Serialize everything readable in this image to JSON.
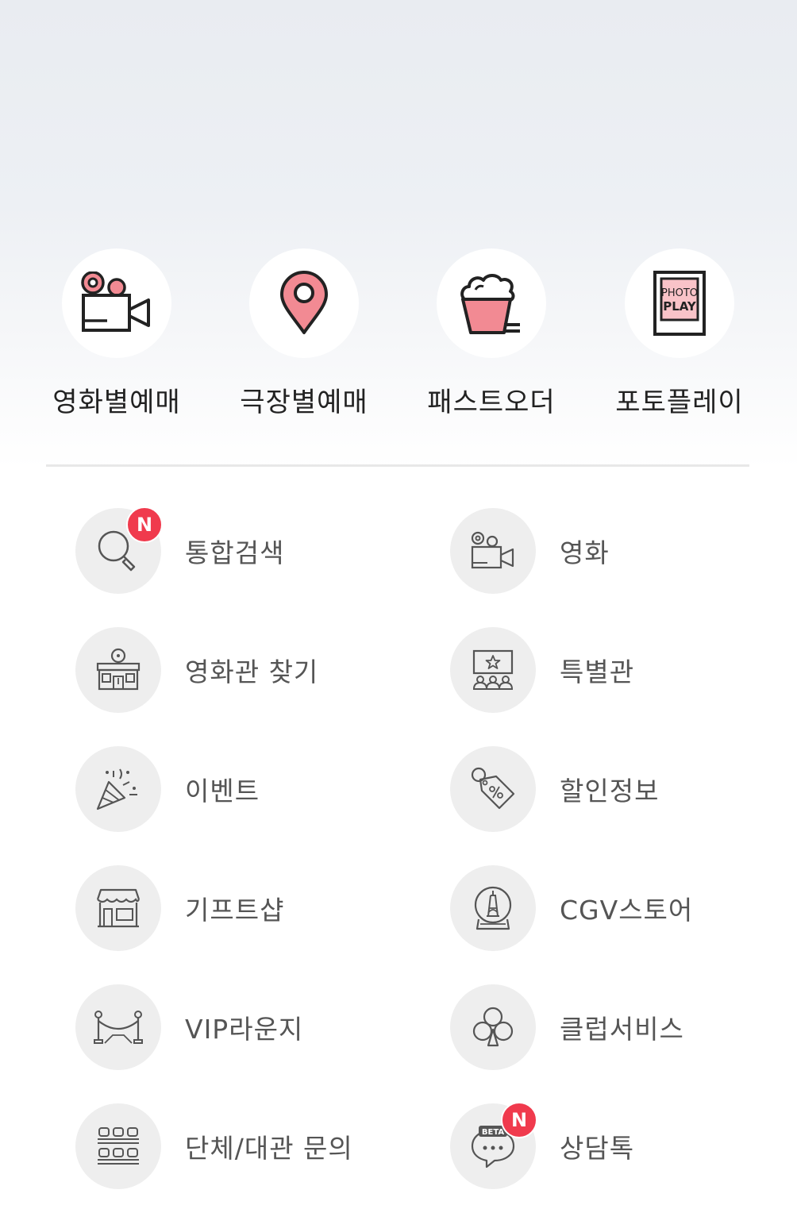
{
  "quick_menu": [
    {
      "label": "영화별예매",
      "icon": "movie-camera-icon"
    },
    {
      "label": "극장별예매",
      "icon": "location-pin-icon"
    },
    {
      "label": "패스트오더",
      "icon": "popcorn-icon"
    },
    {
      "label": "포토플레이",
      "icon": "photo-play-icon",
      "icon_text_1": "PHOTO",
      "icon_text_2": "PLAY"
    }
  ],
  "menu": [
    {
      "label": "통합검색",
      "icon": "search-icon",
      "badge": "N"
    },
    {
      "label": "영화",
      "icon": "movie-camera-icon"
    },
    {
      "label": "영화관 찾기",
      "icon": "theater-building-icon"
    },
    {
      "label": "특별관",
      "icon": "special-theater-icon"
    },
    {
      "label": "이벤트",
      "icon": "party-popper-icon"
    },
    {
      "label": "할인정보",
      "icon": "discount-tag-icon"
    },
    {
      "label": "기프트샵",
      "icon": "gift-shop-icon"
    },
    {
      "label": "CGV스토어",
      "icon": "snow-globe-icon"
    },
    {
      "label": "VIP라운지",
      "icon": "vip-rope-icon"
    },
    {
      "label": "클럽서비스",
      "icon": "club-icon"
    },
    {
      "label": "단체/대관 문의",
      "icon": "group-seats-icon"
    },
    {
      "label": "상담톡",
      "icon": "chat-bubble-icon",
      "badge": "N",
      "icon_text": "BETA"
    }
  ],
  "colors": {
    "accent": "#f28a93",
    "badge": "#f03a4d",
    "label_text": "#555555",
    "quick_label_text": "#222222"
  }
}
